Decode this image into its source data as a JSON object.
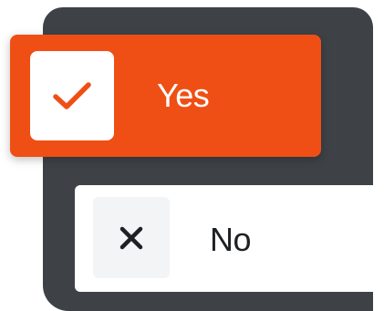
{
  "options": [
    {
      "label": "Yes",
      "selected": true,
      "icon": "check-icon",
      "color": "#ef4f15"
    },
    {
      "label": "No",
      "selected": false,
      "icon": "close-icon",
      "color": "#ffffff"
    }
  ],
  "colors": {
    "panel": "#3e4247",
    "accent": "#ef4f15",
    "text_dark": "#1e2124"
  }
}
